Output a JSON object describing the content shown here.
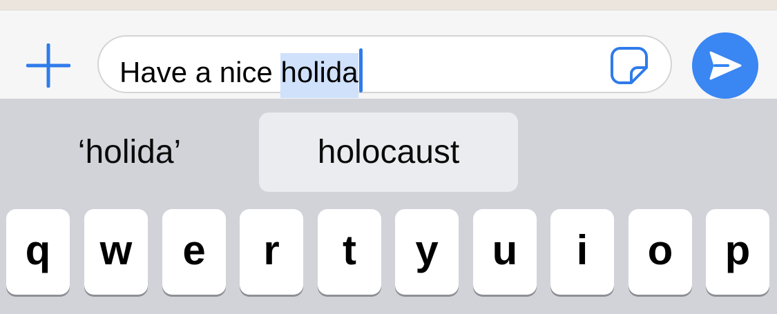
{
  "compose": {
    "typed_text": "Have a nice ",
    "selected_text": "holida",
    "icons": {
      "plus": "plus-icon",
      "sticker": "sticker-icon",
      "send": "send-icon"
    },
    "accent_color": "#3a86f2"
  },
  "predictive": {
    "suggestions": [
      "‘holida’",
      "holocaust",
      ""
    ],
    "highlighted_index": 1
  },
  "keyboard": {
    "row1": [
      "q",
      "w",
      "e",
      "r",
      "t",
      "y",
      "u",
      "i",
      "o",
      "p"
    ]
  }
}
